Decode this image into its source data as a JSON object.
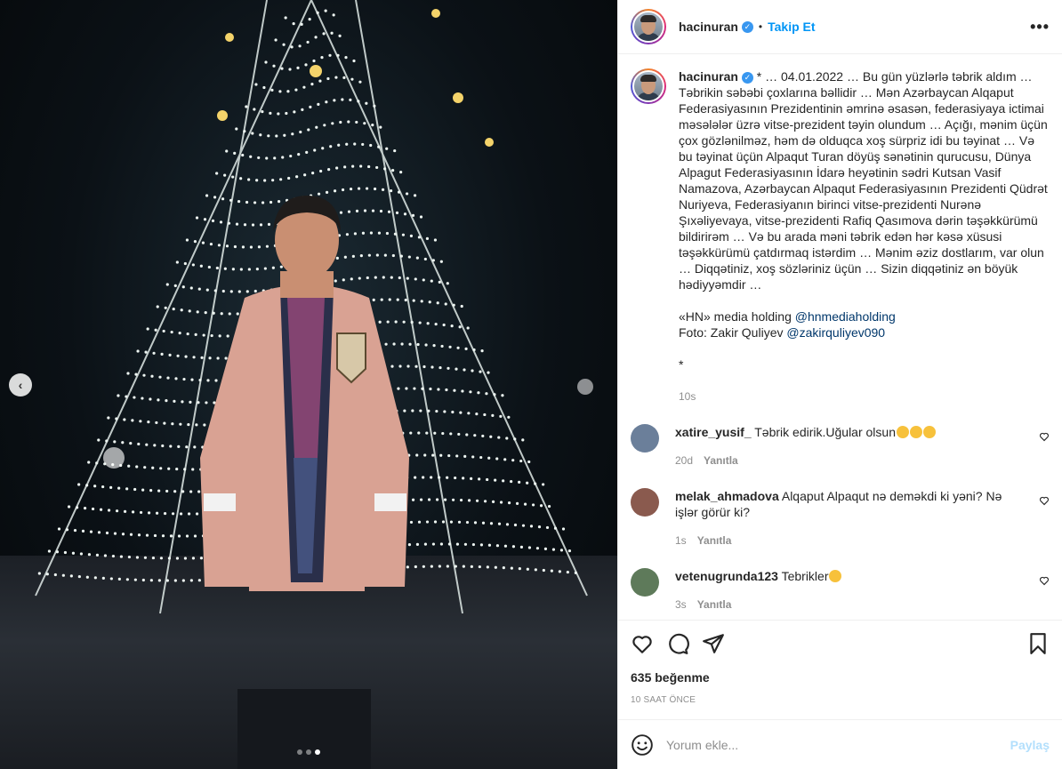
{
  "header": {
    "username": "hacinuran",
    "separator": "•",
    "follow_label": "Takip Et",
    "more_label": "•••"
  },
  "caption": {
    "username": "hacinuran",
    "text": "* … 04.01.2022 … Bu gün yüzlərlə təbrik aldım … Təbrikin səbəbi çoxlarına bəllidir … Mən Azərbaycan Alqaput Federasiyasının Prezidentinin əmrinə əsasən, federasiyaya ictimai məsələlər üzrə vitse-prezident təyin olundum … Açığı, mənim üçün çox gözlənilməz, həm də olduqca xoş sürpriz idi bu təyinat … Və bu təyinat üçün Alpaqut Turan döyüş sənətinin qurucusu, Dünya Alpagut Federasiyasının İdarə heyətinin sədri Kutsan Vasif Namazova, Azərbaycan Alpaqut Federasiyasının Prezidenti Qüdrət Nuriyeva, Federasiyanın birinci vitse-prezidenti Nurənə Şıxəliyevaya, vitse-prezidenti Rafiq Qasımova dərin təşəkkürümü bildirirəm … Və bu arada məni təbrik edən hər kəsə xüsusi təşəkkürümü çatdırmaq istərdim … Mənim əziz dostlarım, var olun … Diqqətiniz, xoş sözləriniz üçün … Sizin diqqətiniz ən böyük hədiyyəmdir …",
    "line_media": "«HN» media holding",
    "mention_media": "@hnmediaholding",
    "line_photo": "Foto: Zakir Quliyev",
    "mention_photo": "@zakirquliyev090",
    "asterisk": "*",
    "age": "10s"
  },
  "comments": [
    {
      "user": "xatire_yusif_",
      "text": "Təbrik edirik.Uğular olsun",
      "emoji_count": 3,
      "age": "20d",
      "reply": "Yanıtla",
      "avatar_color": "#6b7f9a"
    },
    {
      "user": "melak_ahmadova",
      "text": "Alqaput Alpaqut nə deməkdi ki yəni? Nə işlər görür ki?",
      "emoji_count": 0,
      "age": "1s",
      "reply": "Yanıtla",
      "avatar_color": "#8a5a4e"
    },
    {
      "user": "vetenugrunda123",
      "text": "Tebrikler",
      "emoji_count": 1,
      "age": "3s",
      "reply": "Yanıtla",
      "avatar_color": "#5e7a5a"
    }
  ],
  "actions": {
    "likes": "635 beğenme",
    "time": "10 SAAT ÖNCE"
  },
  "add_comment": {
    "placeholder": "Yorum ekle...",
    "post_label": "Paylaş"
  },
  "media": {
    "prev_arrow": "‹",
    "dots": 3,
    "active_dot": 2
  },
  "colors": {
    "link": "#0095f6",
    "mention": "#00376b",
    "muted": "#8e8e8e",
    "verified": "#3897f0"
  }
}
